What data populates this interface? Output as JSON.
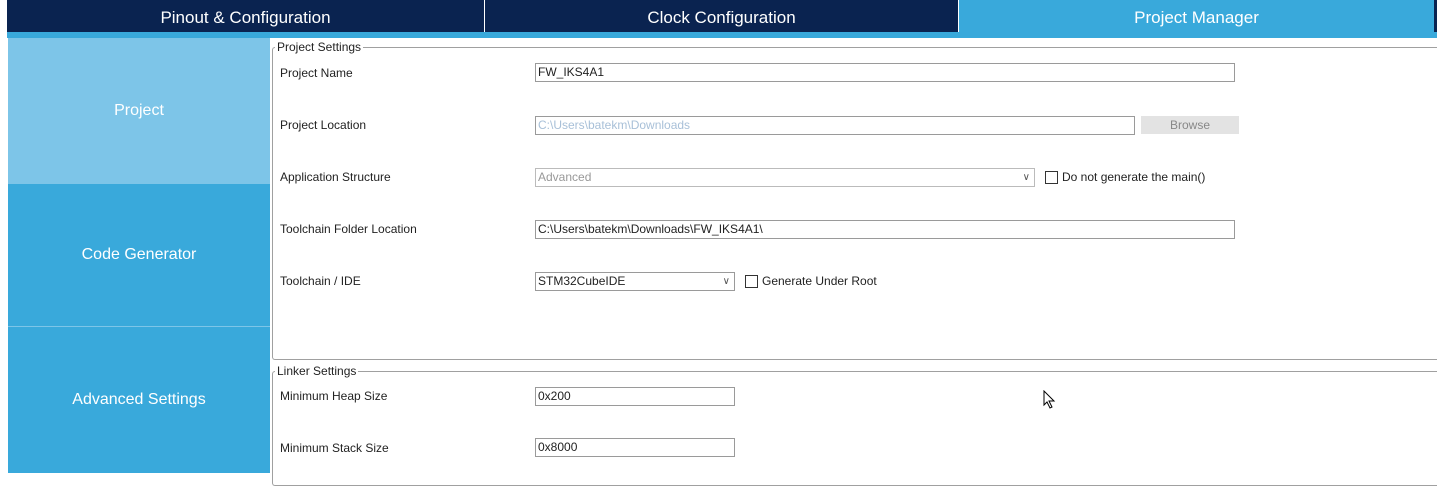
{
  "tabs": [
    {
      "label": "Pinout & Configuration"
    },
    {
      "label": "Clock Configuration"
    },
    {
      "label": "Project Manager",
      "active": true
    }
  ],
  "sidebar": {
    "items": [
      {
        "label": "Project"
      },
      {
        "label": "Code Generator"
      },
      {
        "label": "Advanced Settings"
      }
    ]
  },
  "project_settings": {
    "legend": "Project Settings",
    "project_name_label": "Project Name",
    "project_name": "FW_IKS4A1",
    "project_location_label": "Project Location",
    "project_location": "C:\\Users\\batekm\\Downloads",
    "browse_label": "Browse",
    "app_structure_label": "Application Structure",
    "app_structure": "Advanced",
    "no_main_label": "Do not generate the main()",
    "toolchain_folder_label": "Toolchain Folder Location",
    "toolchain_folder": "C:\\Users\\batekm\\Downloads\\FW_IKS4A1\\",
    "toolchain_ide_label": "Toolchain / IDE",
    "toolchain_ide": "STM32CubeIDE",
    "gen_root_label": "Generate Under Root"
  },
  "linker_settings": {
    "legend": "Linker Settings",
    "heap_label": "Minimum Heap Size",
    "heap": "0x200",
    "stack_label": "Minimum Stack Size",
    "stack": "0x8000"
  },
  "colors": {
    "navy": "#0a2350",
    "accent": "#39a9db",
    "sidebar_active": "#7dc5e8"
  }
}
